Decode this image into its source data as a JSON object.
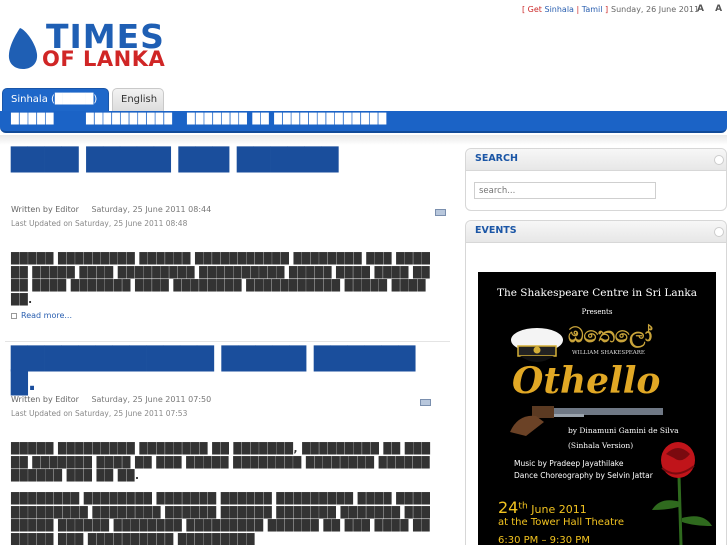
{
  "logo": {
    "line1": "TIMES",
    "line2": "OF LANKA"
  },
  "top_links": {
    "open_bracket": "[",
    "get": "Get",
    "sinhala": "Sinhala",
    "pipe": "|",
    "tamil": "Tamil",
    "close_bracket": "]",
    "date": "Sunday, 26 June 2011",
    "font_sizes": "A A A"
  },
  "tabs": {
    "active": "Sinhala (█████)",
    "other": "English"
  },
  "nav": {
    "items": [
      "█████",
      "██████████",
      "███████ ██ █████████████"
    ]
  },
  "articles": [
    {
      "title": "████ █████ ███ ██████",
      "written_by": "Written by Editor",
      "date": "Saturday, 25 June 2011 08:44",
      "updated": "Last Updated on Saturday, 25 June 2011 08:48",
      "body": "█████ █████████ ██████ ███████████ ████████ ███ ██████ █████ ████ █████████ ██████████ █████ ████ ████ ████ ████ ███████ ████ ████████ ███████████ █████ ████ ██.",
      "read_more": "Read more..."
    },
    {
      "title": "████████████ █████ ███████.",
      "written_by": "Written by Editor",
      "date": "Saturday, 25 June 2011 07:50",
      "updated": "Last Updated on Saturday, 25 June 2011 07:53",
      "body": "█████ █████████ ████████ ██ ███████, █████████ ██ █████ ███████ ████ ██ ███ █████ ████████ ████████ ████████████ ███ ██ ██.",
      "body2": "████████ ████████ ███████ ██████ █████████ ████ ████ █████████ ████████ ██████ ██████ ███████ ███████ ████████ ██████ ████████ █████████ ██████ ██ ███ ████ ███████ ███ ██████████ █████████"
    }
  ],
  "sidebar": {
    "search": {
      "title": "SEARCH",
      "placeholder": "search..."
    },
    "events": {
      "title": "EVENTS",
      "poster": {
        "line1": "The Shakespeare Centre in Sri Lanka",
        "line2": "Presents",
        "sinhala_title": "ඔතෙලෝ",
        "author": "WILLIAM SHAKESPEARE",
        "title": "Othello",
        "by": "by Dinamuni Gamini de Silva",
        "version": "(Sinhala Version)",
        "music": "Music by Pradeep Jayathilake",
        "dance": "Dance Choreography by Selvin Jattar",
        "date_day": "24",
        "date_sup": "th",
        "date_rest": "June 2011",
        "venue": "at the Tower Hall Theatre",
        "time": "6:30 PM – 9:30 PM"
      }
    }
  },
  "colors": {
    "brand_blue": "#1b63c6",
    "brand_red": "#d02626",
    "title_blue": "#1a4e9c"
  }
}
